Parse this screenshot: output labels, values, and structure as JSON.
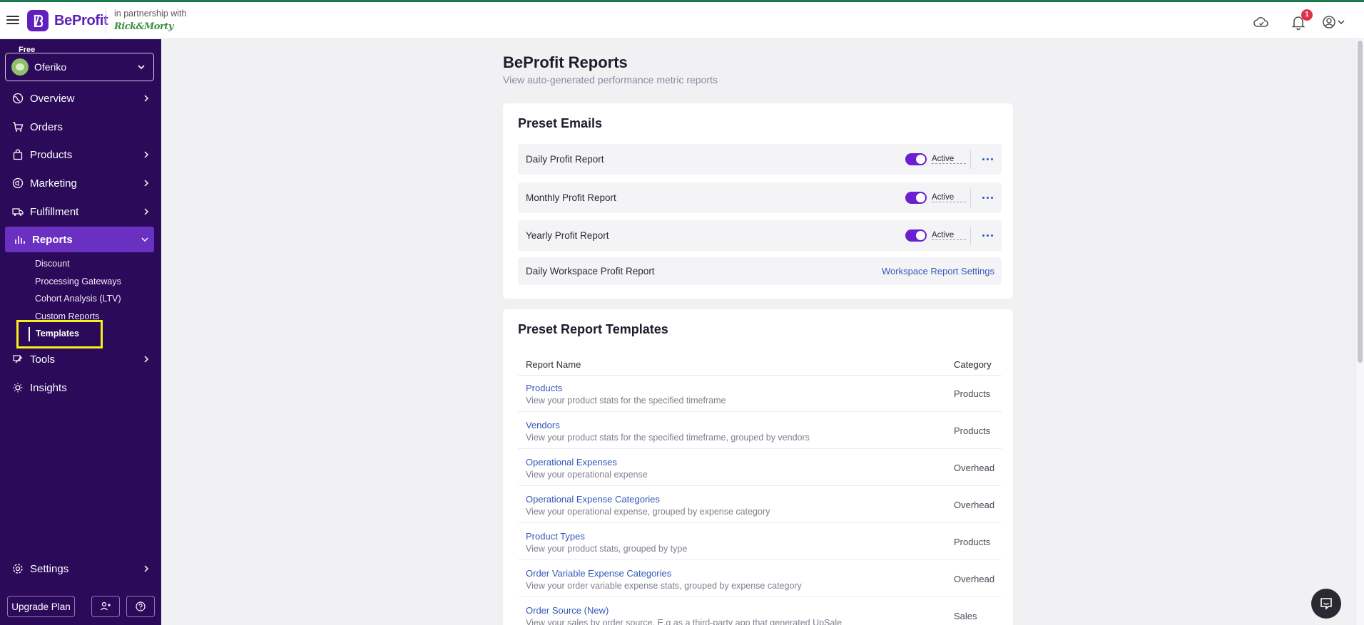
{
  "header": {
    "brand": "BeProfit",
    "partner_text": "in partnership with",
    "partner_logo": "Rick and Morty",
    "notification_count": "1",
    "icons": [
      "menu-icon",
      "cloud-sync-icon",
      "bell-icon",
      "user-account-icon"
    ]
  },
  "sidebar": {
    "plan": "Free",
    "store": "Oferiko",
    "nav": [
      {
        "label": "Overview",
        "icon": "globe-icon",
        "arrow": true
      },
      {
        "label": "Orders",
        "icon": "cart-icon",
        "arrow": false
      },
      {
        "label": "Products",
        "icon": "bag-icon",
        "arrow": true
      },
      {
        "label": "Marketing",
        "icon": "megaphone-icon",
        "arrow": true
      },
      {
        "label": "Fulfillment",
        "icon": "truck-icon",
        "arrow": true
      },
      {
        "label": "Reports",
        "icon": "bar-chart-icon",
        "arrow": true,
        "active": true
      },
      {
        "label": "Tools",
        "icon": "tools-icon",
        "arrow": true
      },
      {
        "label": "Insights",
        "icon": "lightbulb-icon",
        "arrow": false
      },
      {
        "label": "Settings",
        "icon": "gear-icon",
        "arrow": true
      }
    ],
    "reports_sub": [
      "Discount",
      "Processing Gateways",
      "Cohort Analysis (LTV)",
      "Custom Reports",
      "Templates"
    ],
    "active_sub": "Templates",
    "upgrade_label": "Upgrade Plan"
  },
  "main": {
    "title": "BeProfit Reports",
    "subtitle": "View auto-generated performance metric reports",
    "preset_emails": {
      "title": "Preset Emails",
      "rows": [
        {
          "name": "Daily Profit Report",
          "status": "Active"
        },
        {
          "name": "Monthly Profit Report",
          "status": "Active"
        },
        {
          "name": "Yearly Profit Report",
          "status": "Active"
        }
      ],
      "workspace_row": {
        "name": "Daily Workspace Profit Report",
        "link": "Workspace Report Settings"
      }
    },
    "templates": {
      "title": "Preset Report Templates",
      "col_name": "Report Name",
      "col_category": "Category",
      "rows": [
        {
          "name": "Products",
          "desc": "View your product stats for the specified timeframe",
          "category": "Products"
        },
        {
          "name": "Vendors",
          "desc": "View your product stats for the specified timeframe, grouped by vendors",
          "category": "Products"
        },
        {
          "name": "Operational Expenses",
          "desc": "View your operational expense",
          "category": "Overhead"
        },
        {
          "name": "Operational Expense Categories",
          "desc": "View your operational expense, grouped by expense category",
          "category": "Overhead"
        },
        {
          "name": "Product Types",
          "desc": "View your product stats, grouped by type",
          "category": "Products"
        },
        {
          "name": "Order Variable Expense Categories",
          "desc": "View your order variable expense stats, grouped by expense category",
          "category": "Overhead"
        },
        {
          "name": "Order Source (New)",
          "desc": "View your sales by order source, E.g as a third-party app that generated UpSale",
          "category": "Sales"
        }
      ]
    }
  }
}
